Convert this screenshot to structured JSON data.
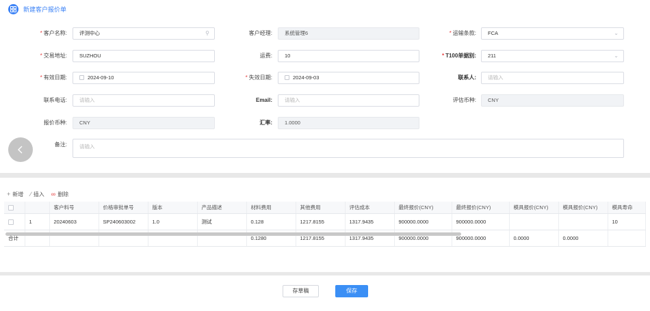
{
  "header": {
    "title": "新建客户报价单"
  },
  "form": {
    "customer_name": {
      "label": "客户名称:",
      "value": "评测中心"
    },
    "customer_manager": {
      "label": "客户经理:",
      "value": "系统管理6"
    },
    "shipping_terms": {
      "label": "运输条款:",
      "value": "FCA"
    },
    "trade_location": {
      "label": "交易地址:",
      "value": "SUZHOU"
    },
    "freight": {
      "label": "运费:",
      "value": "10"
    },
    "t100_type": {
      "label": "T100单据别:",
      "value": "211"
    },
    "valid_date": {
      "label": "有效日期:",
      "value": "2024-09-10"
    },
    "expire_date": {
      "label": "失效日期:",
      "value": "2024-09-03"
    },
    "contact": {
      "label": "联系人:",
      "placeholder": "请输入"
    },
    "phone": {
      "label": "联系电话:",
      "placeholder": "请输入"
    },
    "email": {
      "label": "Email:",
      "placeholder": "请输入"
    },
    "eval_currency": {
      "label": "评估币种:",
      "value": "CNY"
    },
    "quote_currency": {
      "label": "报价币种:",
      "value": "CNY"
    },
    "exchange_rate": {
      "label": "汇率:",
      "value": "1.0000"
    },
    "notes": {
      "label": "备注:",
      "placeholder": "请输入"
    }
  },
  "toolbar": {
    "add": "新增",
    "insert": "插入",
    "delete": "删除"
  },
  "table": {
    "headers": [
      "",
      "",
      "客户料号",
      "价格审批单号",
      "版本",
      "产品描述",
      "材料费用",
      "其他费用",
      "评估成本",
      "最终报价(CNY)",
      "最终报价(CNY)",
      "模具报价(CNY)",
      "模具报价(CNY)",
      "模具寿命"
    ],
    "rows": [
      [
        "",
        "1",
        "20240603",
        "SP240603002",
        "1.0",
        "测试",
        "0.128",
        "1217.8155",
        "1317.9435",
        "900000.0000",
        "900000.0000",
        "",
        "",
        "10"
      ]
    ],
    "summary": [
      "合计",
      "",
      "",
      "",
      "",
      "",
      "0.1280",
      "1217.8155",
      "1317.9435",
      "900000.0000",
      "900000.0000",
      "0.0000",
      "0.0000",
      ""
    ]
  },
  "buttons": {
    "draft": "存草稿",
    "save": "保存"
  },
  "colors": {
    "primary": "#3b8ff5",
    "required": "#e53e3e"
  }
}
